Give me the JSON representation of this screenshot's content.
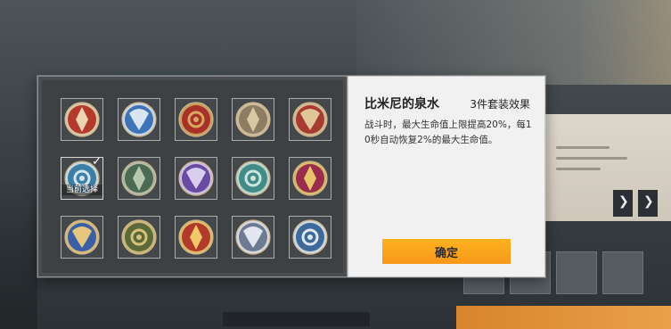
{
  "set_panel": {
    "name": "比米尼的泉水",
    "count_label": "3件套装效果",
    "description": "战斗时，最大生命值上限提高20%，每10秒自动恢复2%的最大生命值。",
    "confirm_label": "确定",
    "selected_label": "当前选择"
  },
  "emblems": [
    {
      "icon": "crimson-phoenix-crest-icon",
      "primary": "#b53a2c",
      "accent": "#e9d5b0"
    },
    {
      "icon": "blue-wings-crest-icon",
      "primary": "#3f73b8",
      "accent": "#d8e4f0"
    },
    {
      "icon": "red-gold-flame-crest-icon",
      "primary": "#a8322a",
      "accent": "#d9a860"
    },
    {
      "icon": "crossed-swords-shield-icon",
      "primary": "#8d7d62",
      "accent": "#d9c9a2"
    },
    {
      "icon": "crimson-ornate-ring-icon",
      "primary": "#a83a30",
      "accent": "#e0c79a"
    },
    {
      "icon": "blue-fountain-wave-icon",
      "primary": "#3a7fa8",
      "accent": "#d6e4ea",
      "selected": true
    },
    {
      "icon": "green-swirl-crown-icon",
      "primary": "#4a6a52",
      "accent": "#b7c7b0"
    },
    {
      "icon": "purple-dragon-mask-icon",
      "primary": "#6a4ba3",
      "accent": "#d7cdef"
    },
    {
      "icon": "teal-infinity-knot-icon",
      "primary": "#3f8d86",
      "accent": "#cfe3df"
    },
    {
      "icon": "magenta-chalice-icon",
      "primary": "#9c2c4e",
      "accent": "#e6c66a"
    },
    {
      "icon": "blue-gold-lotus-icon",
      "primary": "#3a5fa8",
      "accent": "#e6c67a"
    },
    {
      "icon": "spartan-helmet-icon",
      "primary": "#5a6a3a",
      "accent": "#d8c27a"
    },
    {
      "icon": "red-sun-banner-icon",
      "primary": "#b23a2a",
      "accent": "#f0c86a"
    },
    {
      "icon": "silver-trident-ring-icon",
      "primary": "#6d7a94",
      "accent": "#e3e8f0"
    },
    {
      "icon": "blue-colosseum-badge-icon",
      "primary": "#3d6a9a",
      "accent": "#dfe8f0"
    }
  ]
}
